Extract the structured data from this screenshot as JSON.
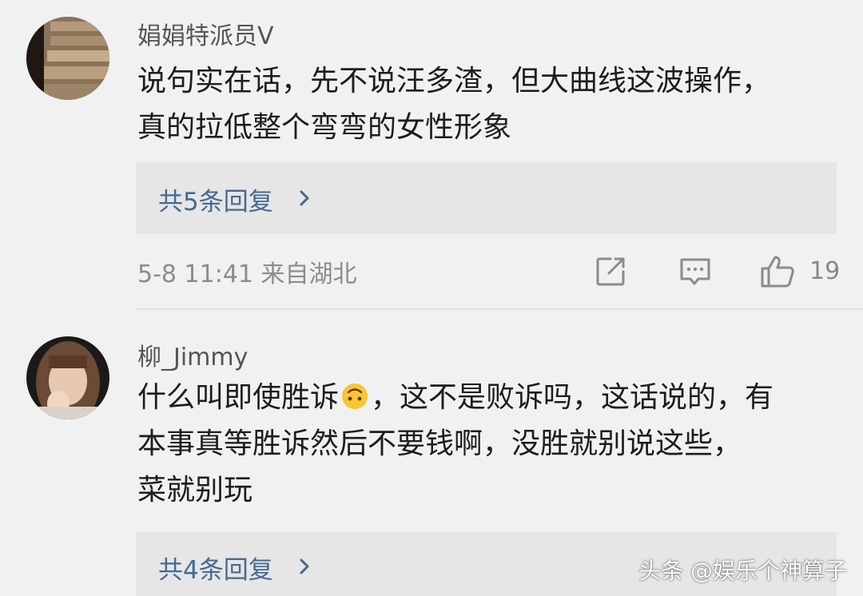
{
  "comments": [
    {
      "username": "娟娟特派员V",
      "lines": [
        "说句实在话，先不说汪多渣，但大曲线这波操作，",
        "真的拉低整个弯弯的女性形象"
      ],
      "replies_label": "共5条回复",
      "meta": "5-8 11:41 来自湖北",
      "like_count": "19"
    },
    {
      "username": "柳_Jimmy",
      "line1_before_emoji": "什么叫即使胜诉",
      "emoji": "upside-down-face",
      "line1_after_emoji": "，这不是败诉吗，这话说的，有",
      "line2": "本事真等胜诉然后不要钱啊，没胜就别说这些，",
      "line3": "菜就别玩",
      "replies_label": "共4条回复"
    }
  ],
  "watermark": "头条 @娱乐个神算子",
  "colors": {
    "background": "#f1f1f1",
    "reply_box": "#e6e6e6",
    "link_blue": "#47698f",
    "meta_gray": "#8c8c8c"
  }
}
